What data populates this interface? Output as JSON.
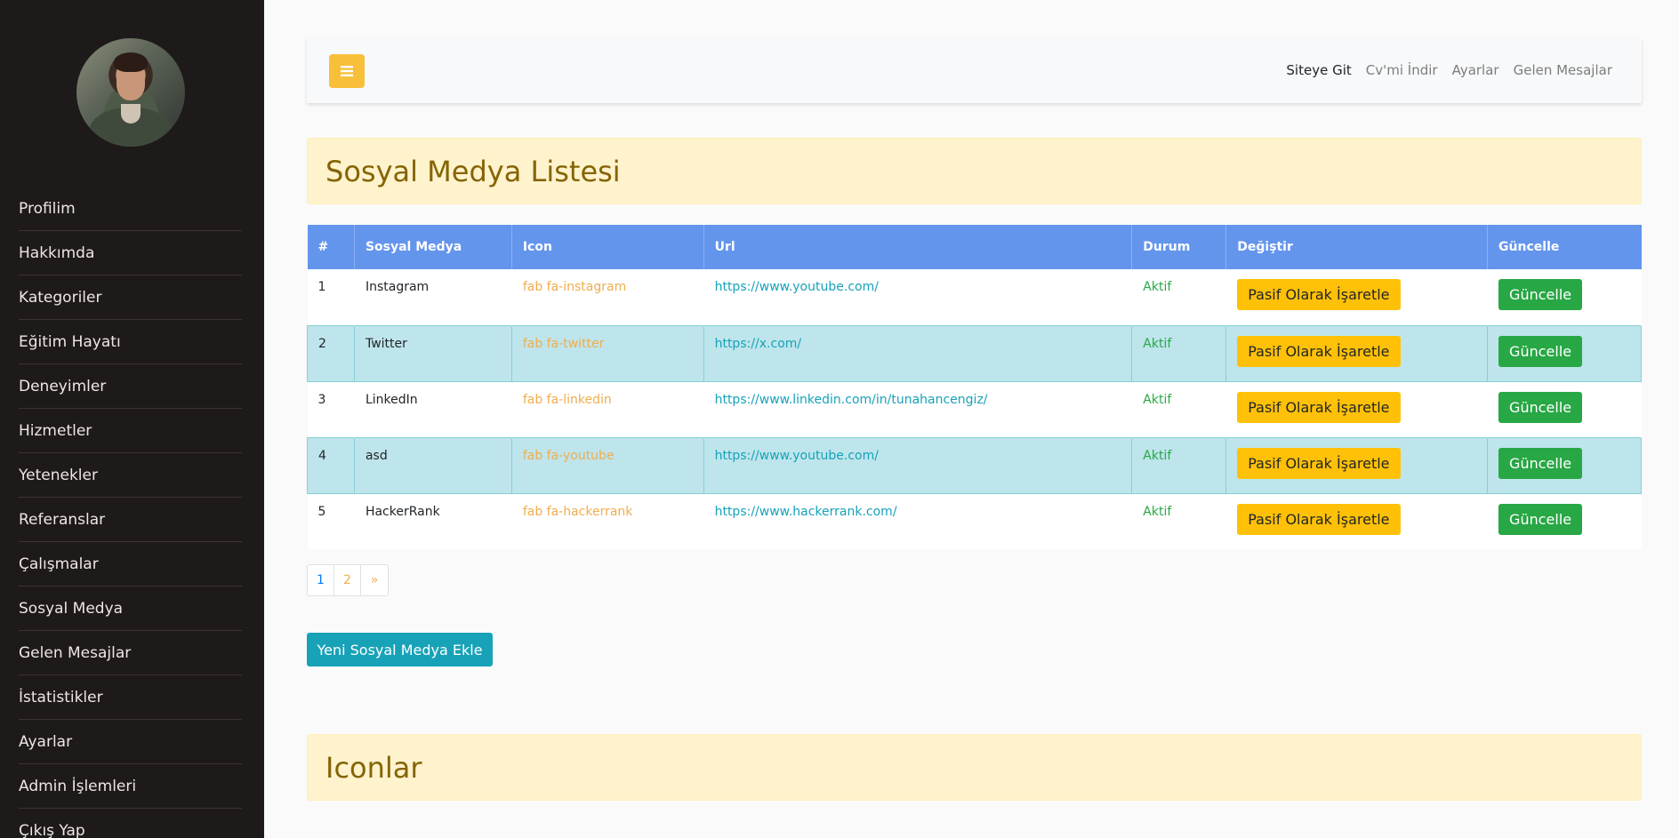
{
  "sidebar": {
    "items": [
      {
        "label": "Profilim"
      },
      {
        "label": "Hakkımda"
      },
      {
        "label": "Kategoriler"
      },
      {
        "label": "Eğitim Hayatı"
      },
      {
        "label": "Deneyimler"
      },
      {
        "label": "Hizmetler"
      },
      {
        "label": "Yetenekler"
      },
      {
        "label": "Referanslar"
      },
      {
        "label": "Çalışmalar"
      },
      {
        "label": "Sosyal Medya"
      },
      {
        "label": "Gelen Mesajlar"
      },
      {
        "label": "İstatistikler"
      },
      {
        "label": "Ayarlar"
      },
      {
        "label": "Admin İşlemleri"
      },
      {
        "label": "Çıkış Yap"
      }
    ]
  },
  "topbar": {
    "toggle_icon": "hamburger-icon",
    "links": [
      {
        "label": "Siteye Git"
      },
      {
        "label": "Cv'mi İndir"
      },
      {
        "label": "Ayarlar"
      },
      {
        "label": "Gelen Mesajlar"
      }
    ]
  },
  "main": {
    "title": "Sosyal Medya Listesi",
    "table": {
      "headers": [
        "#",
        "Sosyal Medya",
        "Icon",
        "Url",
        "Durum",
        "Değiştir",
        "Güncelle"
      ],
      "rows": [
        {
          "id": "1",
          "name": "Instagram",
          "icon": "fab fa-instagram",
          "url": "https://www.youtube.com/",
          "status": "Aktif",
          "toggle": "Pasif Olarak İşaretle",
          "update": "Güncelle"
        },
        {
          "id": "2",
          "name": "Twitter",
          "icon": "fab fa-twitter",
          "url": "https://x.com/",
          "status": "Aktif",
          "toggle": "Pasif Olarak İşaretle",
          "update": "Güncelle"
        },
        {
          "id": "3",
          "name": "LinkedIn",
          "icon": "fab fa-linkedin",
          "url": "https://www.linkedin.com/in/tunahancengiz/",
          "status": "Aktif",
          "toggle": "Pasif Olarak İşaretle",
          "update": "Güncelle"
        },
        {
          "id": "4",
          "name": "asd",
          "icon": "fab fa-youtube",
          "url": "https://www.youtube.com/",
          "status": "Aktif",
          "toggle": "Pasif Olarak İşaretle",
          "update": "Güncelle"
        },
        {
          "id": "5",
          "name": "HackerRank",
          "icon": "fab fa-hackerrank",
          "url": "https://www.hackerrank.com/",
          "status": "Aktif",
          "toggle": "Pasif Olarak İşaretle",
          "update": "Güncelle"
        }
      ]
    },
    "pagination": {
      "pages": [
        "1",
        "2"
      ],
      "next": "»"
    },
    "add_button": "Yeni Sosyal Medya Ekle",
    "icons_title": "Iconlar"
  },
  "colors": {
    "sidebar_bg": "#1e1a19",
    "header_blue": "#6495ed",
    "warning": "#ffc107",
    "success": "#28a745",
    "info": "#17a2b8",
    "alert_bg": "#fff3cd"
  }
}
